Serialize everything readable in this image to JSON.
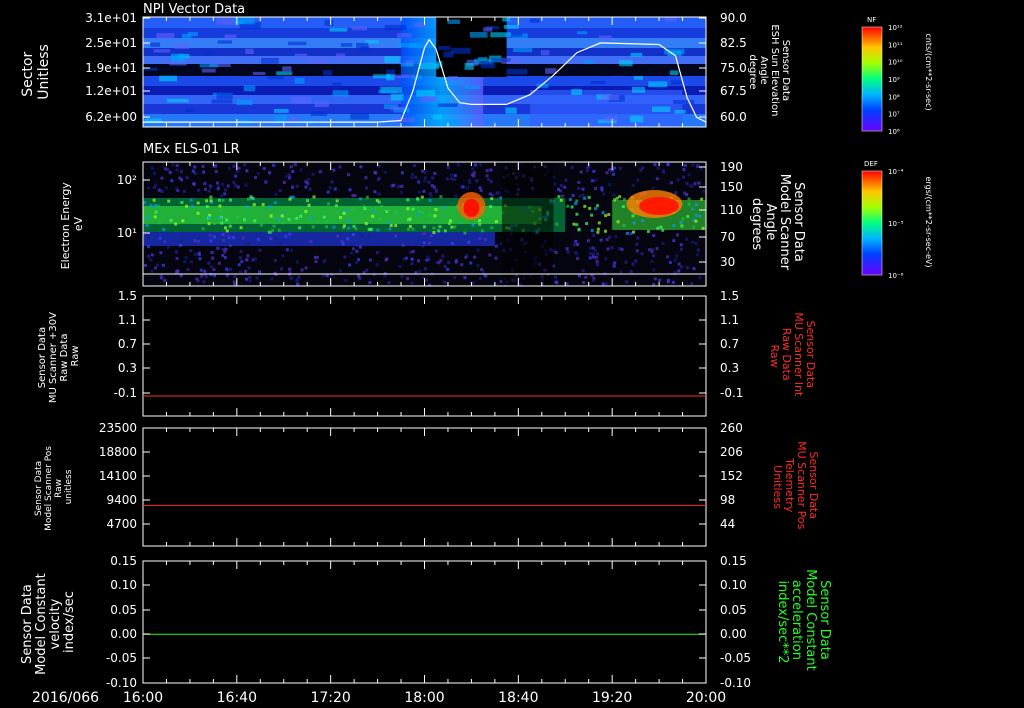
{
  "colors": {
    "axis": "#ffffff",
    "red_trace": "#ff2a2a",
    "green_trace": "#22ff22",
    "white_trace": "#ffffff"
  },
  "chart_data": [
    {
      "type": "heatmap",
      "title": "NPI Vector Data",
      "ylabel_left": [
        "Sector",
        "Unitless"
      ],
      "yticks_left": [
        "3.1e+01",
        "2.5e+01",
        "1.9e+01",
        "1.2e+01",
        "6.2e+00"
      ],
      "ylabel_right": [
        "Sensor Data",
        "ESH Sun Elevation",
        "Angle",
        "degree"
      ],
      "yticks_right": [
        "90.0",
        "82.5",
        "75.0",
        "67.5",
        "60.0"
      ],
      "yrange_right": [
        56,
        90
      ],
      "overlay_series": {
        "name": "ESH Sun Elevation Angle",
        "x": [
          "16:00",
          "17:40",
          "17:50",
          "17:55",
          "18:00",
          "18:02",
          "18:05",
          "18:10",
          "18:15",
          "18:20",
          "18:35",
          "18:45",
          "18:55",
          "19:05",
          "19:15",
          "19:40",
          "19:47",
          "19:52",
          "19:56",
          "20:00"
        ],
        "y": [
          57.5,
          57.5,
          58,
          67,
          80.5,
          83,
          80,
          68,
          63.5,
          63,
          63,
          66,
          72,
          79,
          82,
          81.5,
          78,
          65,
          59,
          57.5
        ]
      },
      "colorbar": {
        "label": "NF",
        "unit": "cnts/(cm**2-sr-sec)",
        "ticks": [
          "10¹²",
          "10¹¹",
          "10¹⁰",
          "10⁹",
          "10⁸",
          "10⁷",
          "10⁶"
        ]
      }
    },
    {
      "type": "heatmap",
      "title": "MEx ELS-01 LR",
      "ylabel_left": [
        "Electron Energy",
        "eV"
      ],
      "yticks_left": [
        "10²",
        "10¹"
      ],
      "ylabel_right": [
        "Sensor Data",
        "Model Scanner",
        "Angle",
        "degrees"
      ],
      "yticks_right": [
        "190",
        "150",
        "110",
        "70",
        "30"
      ],
      "colorbar": {
        "label": "DEF",
        "unit": "ergs/(cm**2-sr-sec-eV)",
        "ticks": [
          "10⁻⁴",
          "10⁻⁵",
          "10⁻⁶"
        ]
      }
    },
    {
      "type": "line",
      "ylabel_left": [
        "Sensor Data",
        "MU Scanner +30V",
        "Raw Data",
        "Raw"
      ],
      "yticks_left": [
        "1.5",
        "1.1",
        "0.7",
        "0.3",
        "-0.1"
      ],
      "ylim_left": [
        -0.3,
        1.5
      ],
      "ylabel_right": [
        "Sensor Data",
        "MU Scanner Int",
        "Raw Data",
        "Raw"
      ],
      "yticks_right": [
        "1.5",
        "1.1",
        "0.7",
        "0.3",
        "-0.1"
      ],
      "series": [
        {
          "color": "#ff2a2a",
          "x": [
            "16:00",
            "20:00"
          ],
          "y": [
            0.0,
            0.0
          ]
        }
      ]
    },
    {
      "type": "line",
      "ylabel_left": [
        "Sensor Data",
        "Model Scanner Pos",
        "Raw",
        "unitless"
      ],
      "yticks_left": [
        "23500",
        "18800",
        "14100",
        "9400",
        "4700"
      ],
      "ylim_left": [
        0,
        23500
      ],
      "ylabel_right": [
        "Sensor Data",
        "MU Scanner Pos",
        "Telemetry",
        "Unitless"
      ],
      "yticks_right": [
        "260",
        "206",
        "152",
        "98",
        "44"
      ],
      "series": [
        {
          "color": "#ff2a2a",
          "x": [
            "16:00",
            "20:00"
          ],
          "y": [
            8100,
            8100
          ]
        }
      ]
    },
    {
      "type": "line",
      "ylabel_left": [
        "Sensor Data",
        "Model Constant",
        "velocity",
        "index/sec"
      ],
      "yticks_left": [
        "0.15",
        "0.10",
        "0.05",
        "0.00",
        "-0.05",
        "-0.10"
      ],
      "ylim_left": [
        -0.1,
        0.15
      ],
      "ylabel_right": [
        "Sensor Data",
        "Model Constant",
        "acceleration",
        "index/sec**2"
      ],
      "yticks_right": [
        "0.15",
        "0.10",
        "0.05",
        "0.00",
        "-0.05",
        "-0.10"
      ],
      "series": [
        {
          "color": "#22ff22",
          "x": [
            "16:00",
            "20:00"
          ],
          "y": [
            0.0,
            0.0
          ]
        }
      ]
    }
  ],
  "x_axis": {
    "date_label": "2016/066",
    "ticks": [
      "16:00",
      "16:40",
      "17:20",
      "18:00",
      "18:40",
      "19:20",
      "20:00"
    ]
  }
}
